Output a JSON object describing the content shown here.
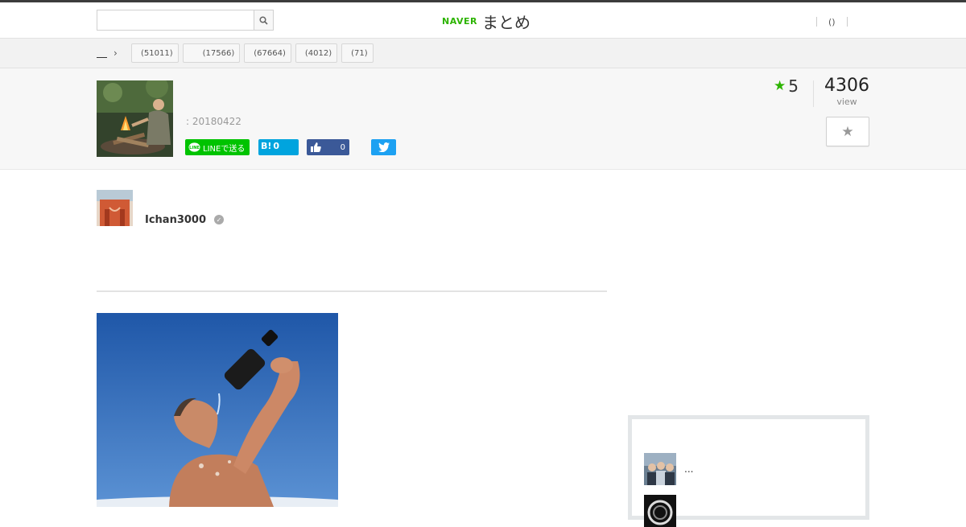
{
  "search": {
    "placeholder": ""
  },
  "logo": {
    "brand": "NAVER",
    "product": "まとめ"
  },
  "user_nav": {
    "link1": "()"
  },
  "breadcrumb": {
    "chevron": "›"
  },
  "category_tags": [
    {
      "count": "(51011)"
    },
    {
      "count": "(17566)"
    },
    {
      "count": "(67664)"
    },
    {
      "count": "(4012)"
    },
    {
      "count": "(71)"
    }
  ],
  "article": {
    "date": ": 20180422",
    "favorites": "5",
    "views": "4306",
    "views_label": "view"
  },
  "share": {
    "line_label": "LINEで送る",
    "hatena_label": "B!",
    "hatena_count": "0",
    "facebook_count": "0"
  },
  "author": {
    "name": "Ichan3000"
  },
  "sidebar": {
    "items": [
      {
        "title": "..."
      },
      {
        "title": ""
      }
    ]
  },
  "colors": {
    "naver_green": "#2db400",
    "line_green": "#00c300",
    "hatena_blue": "#00a4de",
    "facebook_blue": "#3b5998",
    "twitter_blue": "#1da1f2"
  }
}
